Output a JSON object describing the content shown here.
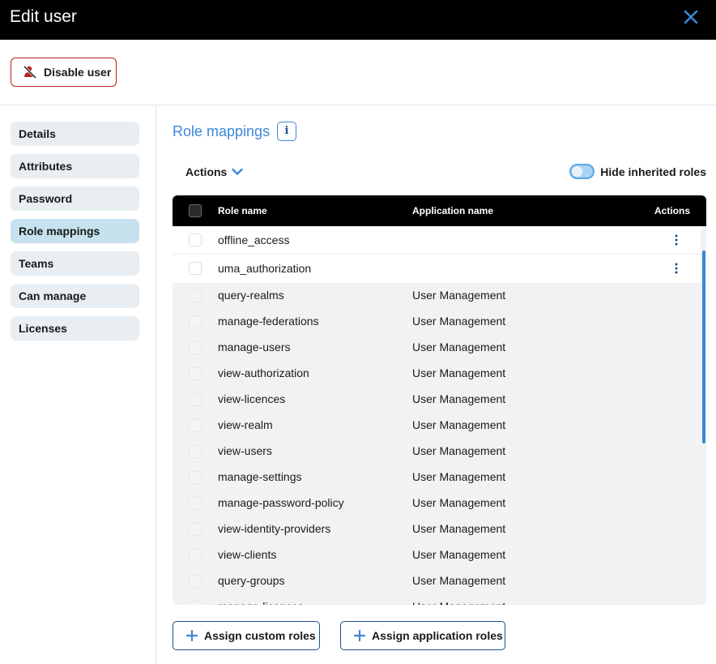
{
  "window": {
    "title": "Edit user"
  },
  "topbar": {
    "disable_label": "Disable user"
  },
  "sidebar": {
    "items": [
      {
        "label": "Details",
        "active": false
      },
      {
        "label": "Attributes",
        "active": false
      },
      {
        "label": "Password",
        "active": false
      },
      {
        "label": "Role mappings",
        "active": true
      },
      {
        "label": "Teams",
        "active": false
      },
      {
        "label": "Can manage",
        "active": false
      },
      {
        "label": "Licenses",
        "active": false
      }
    ]
  },
  "main": {
    "section_title": "Role mappings",
    "info_label": "i",
    "actions_label": "Actions",
    "toggle_label": "Hide inherited roles",
    "toggle_on": false
  },
  "table": {
    "headers": [
      "Role name",
      "Application name",
      "Actions"
    ],
    "direct_rows": [
      {
        "role": "offline_access",
        "app": ""
      },
      {
        "role": "uma_authorization",
        "app": ""
      }
    ],
    "inherited_rows": [
      {
        "role": "query-realms",
        "app": "User Management"
      },
      {
        "role": "manage-federations",
        "app": "User Management"
      },
      {
        "role": "manage-users",
        "app": "User Management"
      },
      {
        "role": "view-authorization",
        "app": "User Management"
      },
      {
        "role": "view-licences",
        "app": "User Management"
      },
      {
        "role": "view-realm",
        "app": "User Management"
      },
      {
        "role": "view-users",
        "app": "User Management"
      },
      {
        "role": "manage-settings",
        "app": "User Management"
      },
      {
        "role": "manage-password-policy",
        "app": "User Management"
      },
      {
        "role": "view-identity-providers",
        "app": "User Management"
      },
      {
        "role": "view-clients",
        "app": "User Management"
      },
      {
        "role": "query-groups",
        "app": "User Management"
      },
      {
        "role": "manage-licences",
        "app": "User Management"
      }
    ]
  },
  "buttons": {
    "assign_custom": "Assign custom roles",
    "assign_application": "Assign application roles"
  },
  "colors": {
    "accent": "#3d86d8",
    "danger": "#b3261e",
    "header_bg": "#000000",
    "active_nav": "#c6e2ee",
    "nav_bg": "#e8eef1"
  },
  "icons": {
    "close": "close-icon",
    "disable": "user-disabled-icon",
    "info": "info-icon",
    "dropdown": "chevron-down-icon",
    "row_menu": "kebab-menu-icon",
    "add": "plus-icon"
  }
}
